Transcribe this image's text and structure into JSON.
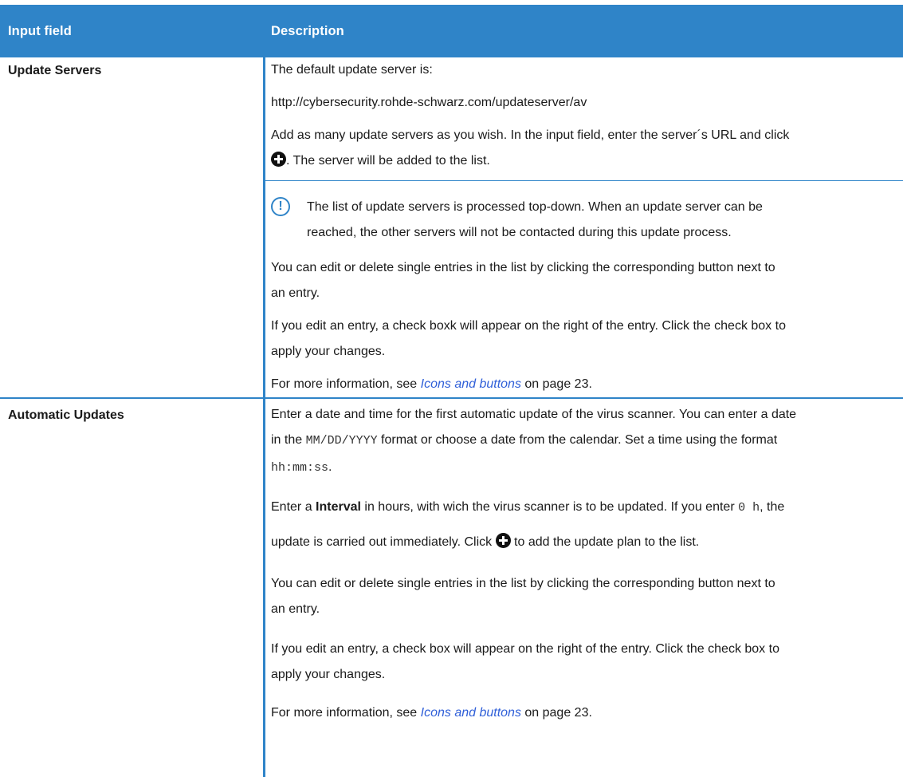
{
  "header": {
    "col1": "Input field",
    "col2": "Description"
  },
  "rows": [
    {
      "field": "Update Servers",
      "lines": {
        "p1": "The default update server is:",
        "p2": "http://cybersecurity.rohde-schwarz.com/updateserver/av",
        "p3a": "Add as many update servers as you wish. In the input field, enter the server´s URL and click",
        "p3b": ". The server will be added to the list.",
        "note1": "The list of update servers is processed top-down. When an update server can be",
        "note2": "reached, the other servers will not be contacted during this update process.",
        "p4a": "You can edit or delete single entries in the list by clicking the corresponding button next to",
        "p4b": "an entry.",
        "p5a": "If you edit an entry, a check boxk will appear on the right of the entry. Click the check box to",
        "p5b": "apply your changes.",
        "p6_pre": "For more information, see ",
        "p6_link": "Icons and buttons",
        "p6_post": " on page 23."
      }
    },
    {
      "field": "Automatic Updates",
      "lines": {
        "p1a": "Enter a date and time for the first automatic update of the virus scanner. You can enter a date",
        "p1b_pre": "in the ",
        "p1b_mono": "MM/DD/YYYY",
        "p1b_post": " format or choose a date from the calendar. Set a time using the format",
        "p1c_mono": "hh:mm:ss",
        "p1c_post": ".",
        "p2_pre": "Enter a ",
        "p2_bold": "Interval",
        "p2_mid": " in hours, with wich the virus scanner is to be updated. If you enter ",
        "p2_mono": "0 h",
        "p2_post": ", the",
        "p2b_pre": "update is carried out immediately. Click ",
        "p2b_post": " to add the update plan to the list.",
        "p3a": "You can edit or delete single entries in the list by clicking the corresponding button next to",
        "p3b": "an entry.",
        "p4a": "If you edit an entry, a check box will appear on the right of the entry. Click the check box to",
        "p4b": "apply your changes.",
        "p5_pre": "For more information, see ",
        "p5_link": "Icons and buttons",
        "p5_post": " on page 23."
      }
    }
  ],
  "icons": {
    "add": "plus-circle-icon",
    "note": "exclamation-circle-icon"
  },
  "colors": {
    "accent": "#2f84c8",
    "link": "#2f5fd8"
  }
}
